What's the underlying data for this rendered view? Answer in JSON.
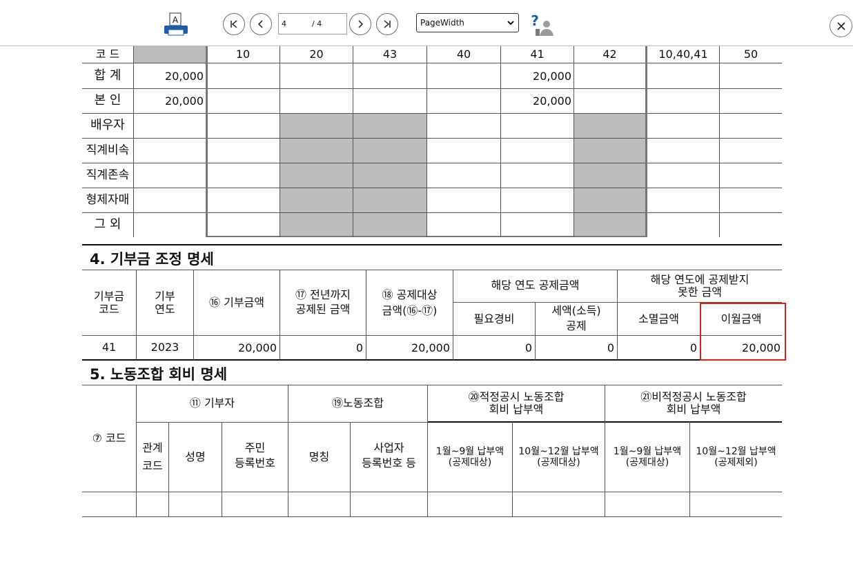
{
  "toolbar": {
    "current_page": "4",
    "total_pages": "/ 4",
    "zoom": "PageWidth",
    "print_label": "A",
    "help_label": "?"
  },
  "section3": {
    "code_label": "코  드",
    "codes": [
      "10",
      "20",
      "43",
      "40",
      "41",
      "42",
      "10,40,41",
      "50"
    ],
    "rows": [
      {
        "label": "합  계",
        "total": "20,000",
        "v41": "20,000"
      },
      {
        "label": "본  인",
        "total": "20,000",
        "v41": "20,000"
      },
      {
        "label": "배우자",
        "total": "",
        "v41": ""
      },
      {
        "label": "직계비속",
        "total": "",
        "v41": ""
      },
      {
        "label": "직계존속",
        "total": "",
        "v41": ""
      },
      {
        "label": "형제자매",
        "total": "",
        "v41": ""
      },
      {
        "label": "그  외",
        "total": "",
        "v41": ""
      }
    ]
  },
  "section4": {
    "title": "4. 기부금 조정 명세",
    "headers": {
      "code": [
        "기부금",
        "코드"
      ],
      "year": [
        "기부",
        "연도"
      ],
      "amount": "⑯ 기부금액",
      "prev": [
        "⑰ 전년까지",
        "공제된 금액"
      ],
      "target": [
        "⑱ 공제대상",
        "금액(⑯-⑰)"
      ],
      "current_group": "해당 연도 공제금액",
      "expense": "필요경비",
      "tax": [
        "세액(소득)",
        "공제"
      ],
      "unused_group": [
        "해당 연도에 공제받지",
        "못한 금액"
      ],
      "expired": "소멸금액",
      "carry": "이월금액"
    },
    "row": {
      "code": "41",
      "year": "2023",
      "amount": "20,000",
      "prev": "0",
      "target": "20,000",
      "expense": "0",
      "tax": "0",
      "expired": "0",
      "carry": "20,000"
    }
  },
  "section5": {
    "title": "5. 노동조합 회비 명세",
    "headers": {
      "code": "⑦ 코드",
      "donor": "⑪ 기부자",
      "union": "⑲노동조합",
      "proper": [
        "⑳적정공시 노동조합",
        "회비 납부액"
      ],
      "improper": [
        "㉑비적정공시 노동조합",
        "회비 납부액"
      ],
      "relation": [
        "관계",
        "코드"
      ],
      "name": "성명",
      "rrn": [
        "주민",
        "등록번호"
      ],
      "union_name": "명칭",
      "bizno": [
        "사업자",
        "등록번호 등"
      ],
      "p1": [
        "1월~9월 납부액",
        "(공제대상)"
      ],
      "p2": [
        "10월~12월 납부액",
        "(공제대상)"
      ],
      "i1": [
        "1월~9월 납부액",
        "(공제대상)"
      ],
      "i2": [
        "10월~12월 납부액",
        "(공제제외)"
      ]
    }
  }
}
